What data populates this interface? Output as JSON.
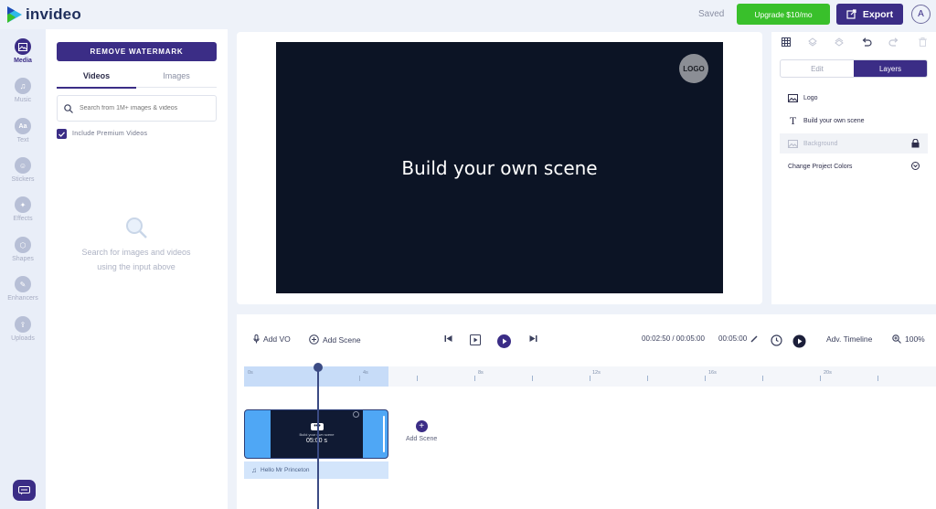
{
  "app": {
    "brand": "invideo",
    "saved_status": "Saved",
    "upgrade_label": "Upgrade $10/mo",
    "export_label": "Export",
    "avatar_initial": "A",
    "accent_color": "#3b2d86",
    "upgrade_color": "#39c02b"
  },
  "sidebar": {
    "items": [
      {
        "label": "Media",
        "icon": "image-icon",
        "active": true
      },
      {
        "label": "Music",
        "icon": "music-icon"
      },
      {
        "label": "Text",
        "icon": "text-icon"
      },
      {
        "label": "Stickers",
        "icon": "sticker-icon"
      },
      {
        "label": "Effects",
        "icon": "effects-icon"
      },
      {
        "label": "Shapes",
        "icon": "shapes-icon"
      },
      {
        "label": "Enhancers",
        "icon": "enhancers-icon"
      },
      {
        "label": "Uploads",
        "icon": "upload-icon"
      }
    ]
  },
  "media_panel": {
    "remove_watermark": "REMOVE WATERMARK",
    "tabs": [
      "Videos",
      "Images"
    ],
    "search_placeholder": "Search from 1M+ images & videos",
    "premium_label": "Include Premium Videos",
    "empty_state_line1": "Search for images and videos",
    "empty_state_line2": "using the input above"
  },
  "canvas": {
    "title": "Build your own scene",
    "logo_text": "LOGO"
  },
  "right_panel": {
    "tabs": [
      "Edit",
      "Layers"
    ],
    "layers": [
      {
        "label": "Logo",
        "icon": "image-layer-icon"
      },
      {
        "label": "Build your own scene",
        "icon": "text-layer-icon"
      },
      {
        "label": "Background",
        "icon": "background-layer-icon",
        "locked": true
      }
    ],
    "change_colors": "Change Project Colors"
  },
  "timeline": {
    "add_vo": "Add VO",
    "add_scene": "Add Scene",
    "time_current": "00:02:50 / 00:05:00",
    "time_scene": "00:05:00",
    "adv_timeline": "Adv. Timeline",
    "zoom": "100%",
    "ruler_labels": [
      "0s",
      "4s",
      "8s",
      "12s",
      "16s",
      "20s"
    ],
    "clip_subtitle": "Build your own scene",
    "clip_duration": "05:00 s",
    "add_scene_label": "Add Scene",
    "audio_track": "Hello Mr Princeton"
  }
}
